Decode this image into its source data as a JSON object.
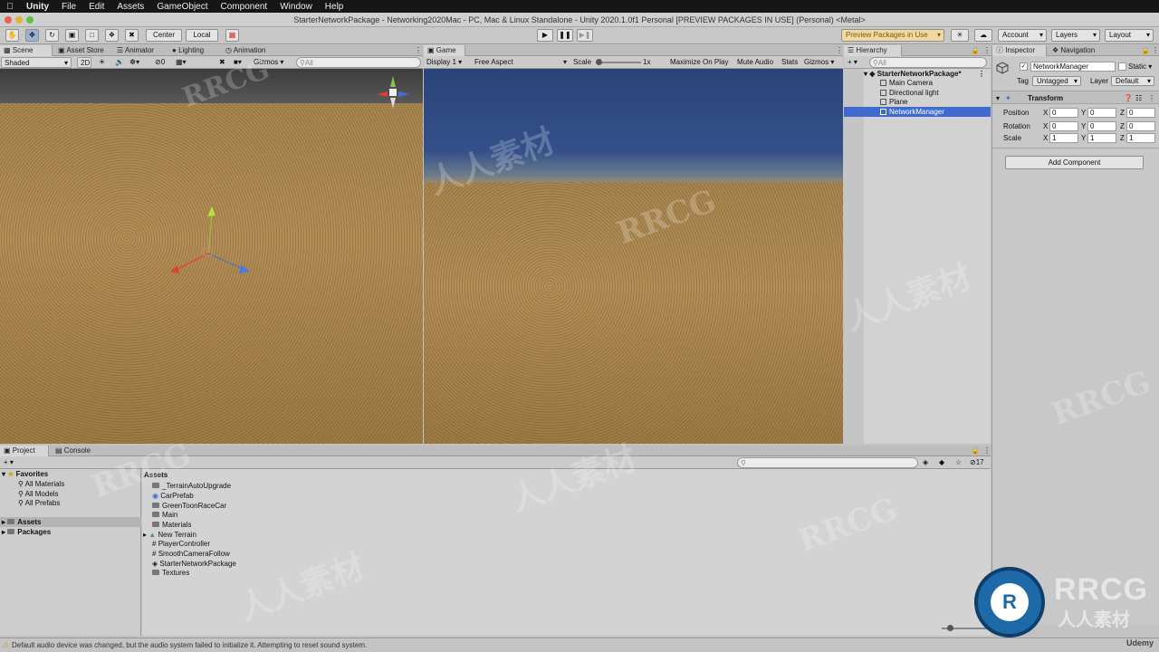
{
  "menubar": {
    "items": [
      "Unity",
      "File",
      "Edit",
      "Assets",
      "GameObject",
      "Component",
      "Window",
      "Help"
    ]
  },
  "window": {
    "title": "StarterNetworkPackage - Networking2020Mac - PC, Mac & Linux Standalone - Unity 2020.1.0f1 Personal [PREVIEW PACKAGES IN USE] (Personal) <Metal>"
  },
  "toolbar": {
    "pivot": "Center",
    "space": "Local",
    "preview_packages": "Preview Packages in Use",
    "account": "Account",
    "layers": "Layers",
    "layout": "Layout"
  },
  "scene_panel": {
    "tabs": [
      "Scene",
      "Asset Store",
      "Animator",
      "Lighting",
      "Animation"
    ],
    "shading": "Shaded",
    "mode_2d": "2D",
    "hidden_count": "0",
    "gizmos": "Gizmos",
    "search_placeholder": "All"
  },
  "game_panel": {
    "tab": "Game",
    "display": "Display 1",
    "aspect": "Free Aspect",
    "scale_label": "Scale",
    "scale_value": "1x",
    "options": [
      "Maximize On Play",
      "Mute Audio",
      "Stats",
      "Gizmos"
    ]
  },
  "hierarchy": {
    "tab": "Hierarchy",
    "search_placeholder": "All",
    "scene": "StarterNetworkPackage*",
    "items": [
      "Main Camera",
      "Directional light",
      "Plane",
      "NetworkManager"
    ]
  },
  "inspector": {
    "tabs": [
      "Inspector",
      "Navigation"
    ],
    "object_name": "NetworkManager",
    "static_label": "Static",
    "tag_label": "Tag",
    "tag_value": "Untagged",
    "layer_label": "Layer",
    "layer_value": "Default",
    "component": "Transform",
    "rows": [
      {
        "label": "Position",
        "x": "0",
        "y": "0",
        "z": "0"
      },
      {
        "label": "Rotation",
        "x": "0",
        "y": "0",
        "z": "0"
      },
      {
        "label": "Scale",
        "x": "1",
        "y": "1",
        "z": "1"
      }
    ],
    "axis": [
      "X",
      "Y",
      "Z"
    ],
    "add_component": "Add Component"
  },
  "project": {
    "tabs": [
      "Project",
      "Console"
    ],
    "favorites": "Favorites",
    "favorite_items": [
      "All Materials",
      "All Models",
      "All Prefabs"
    ],
    "roots": [
      "Assets",
      "Packages"
    ],
    "breadcrumb": "Assets",
    "hidden_count": "17",
    "assets": [
      "_TerrainAutoUpgrade",
      "CarPrefab",
      "GreenToonRaceCar",
      "Main",
      "Materials",
      "New Terrain",
      "PlayerController",
      "SmoothCameraFollow",
      "StarterNetworkPackage",
      "Textures"
    ]
  },
  "status": {
    "message": "Default audio device was changed, but the audio system failed to initialize it. Attempting to reset sound system."
  },
  "watermark": {
    "logo": "RRCG",
    "sub": "人人素材",
    "corner": "Udemy"
  }
}
